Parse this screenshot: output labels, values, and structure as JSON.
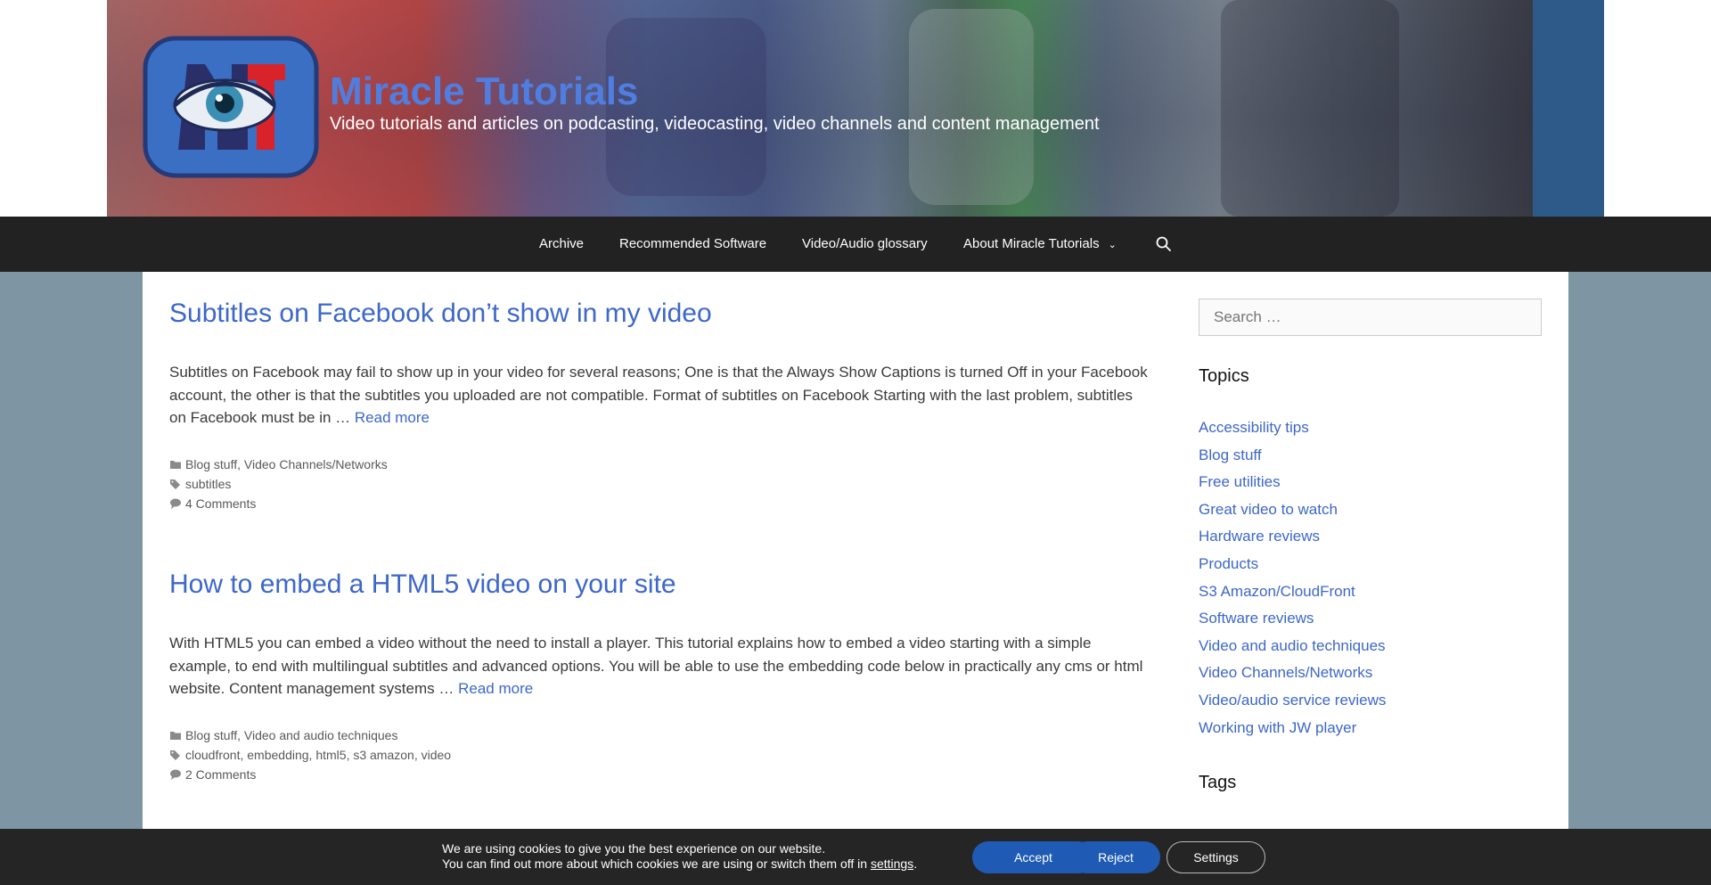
{
  "header": {
    "title": "Miracle Tutorials",
    "tagline": "Video tutorials and articles on podcasting, videocasting, video channels and content management",
    "logo_text": "MT",
    "colors": {
      "title": "#4f7ee0",
      "logo_bg": "#3a6fc4",
      "logo_navy": "#2a2f6a",
      "logo_red": "#d8232a"
    }
  },
  "nav": {
    "items": [
      {
        "label": "Archive"
      },
      {
        "label": "Recommended Software"
      },
      {
        "label": "Video/Audio glossary"
      },
      {
        "label": "About Miracle Tutorials",
        "has_dropdown": true
      }
    ],
    "search_icon": "search-icon",
    "dropdown_icon": "chevron-down-icon"
  },
  "posts": [
    {
      "title": "Subtitles on Facebook don’t show in my video",
      "excerpt": "Subtitles on Facebook may fail to show up in your video for several reasons; One is that the Always Show Captions is turned Off in your Facebook account, the other is that the subtitles you uploaded are not compatible. Format of subtitles on Facebook Starting with the last problem, subtitles on Facebook must be in … ",
      "read_more": "Read more",
      "categories": [
        "Blog stuff",
        "Video Channels/Networks"
      ],
      "tags": [
        "subtitles"
      ],
      "comments": "4 Comments"
    },
    {
      "title": "How to embed a HTML5 video on your site",
      "excerpt": "With HTML5 you can embed a video without the need to install a player.  This tutorial explains how to embed a video starting with a simple example, to end with multilingual subtitles and advanced options. You will be able to use the embedding code below in practically any cms or html website. Content management systems … ",
      "read_more": "Read more",
      "categories": [
        "Blog stuff",
        "Video and audio techniques"
      ],
      "tags": [
        "cloudfront",
        "embedding",
        "html5",
        "s3 amazon",
        "video"
      ],
      "comments": "2 Comments"
    }
  ],
  "sidebar": {
    "search_placeholder": "Search …",
    "topics_title": "Topics",
    "topics": [
      "Accessibility tips",
      "Blog stuff",
      "Free utilities",
      "Great video to watch",
      "Hardware reviews",
      "Products",
      "S3 Amazon/CloudFront",
      "Software reviews",
      "Video and audio techniques",
      "Video Channels/Networks",
      "Video/audio service reviews",
      "Working with JW player"
    ],
    "tags_title": "Tags"
  },
  "cookie": {
    "line1": "We are using cookies to give you the best experience on our website.",
    "line2_prefix": "You can find out more about which cookies we are using or switch them off in ",
    "line2_link": "settings",
    "line2_suffix": ".",
    "accept": "Accept",
    "reject": "Reject",
    "settings": "Settings",
    "accent": "#1f5bb4"
  },
  "colors": {
    "link": "#3d67c9",
    "nav_bg": "#222222",
    "page_bg": "#7e96a3",
    "cookie_bg": "#252525"
  }
}
